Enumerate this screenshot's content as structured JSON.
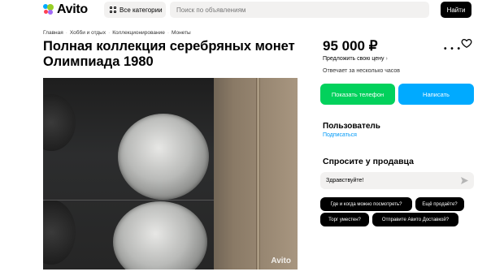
{
  "header": {
    "logo_text": "Avito",
    "categories_label": "Все категории",
    "search_placeholder": "Поиск по объявлениям",
    "find_label": "Найти"
  },
  "breadcrumbs": [
    "Главная",
    "Хобби и отдых",
    "Коллекционирование",
    "Монеты"
  ],
  "listing": {
    "title": "Полная коллекция серебряных монет Олимпиада 1980",
    "photo_watermark": "Avito"
  },
  "sidebar": {
    "price": "95 000 ₽",
    "offer_price_label": "Предложить свою цену",
    "reply_time": "Отвечает за несколько часов",
    "show_phone_label": "Показать телефон",
    "write_label": "Написать",
    "seller_name": "Пользователь",
    "subscribe_label": "Подписаться",
    "ask_title": "Спросите у продавца",
    "message_value": "Здравствуйте!",
    "quick_questions": [
      "Где и когда можно посмотреть?",
      "Ещё продаёте?",
      "Торг уместен?",
      "Отправите Авито Доставкой?"
    ]
  },
  "colors": {
    "green_button": "#02d15c",
    "blue_button": "#00aaff",
    "link": "#0099f7"
  },
  "icons": [
    "logo-icon",
    "grid-icon",
    "more-icon",
    "heart-icon",
    "chevron-right-icon",
    "send-icon"
  ]
}
